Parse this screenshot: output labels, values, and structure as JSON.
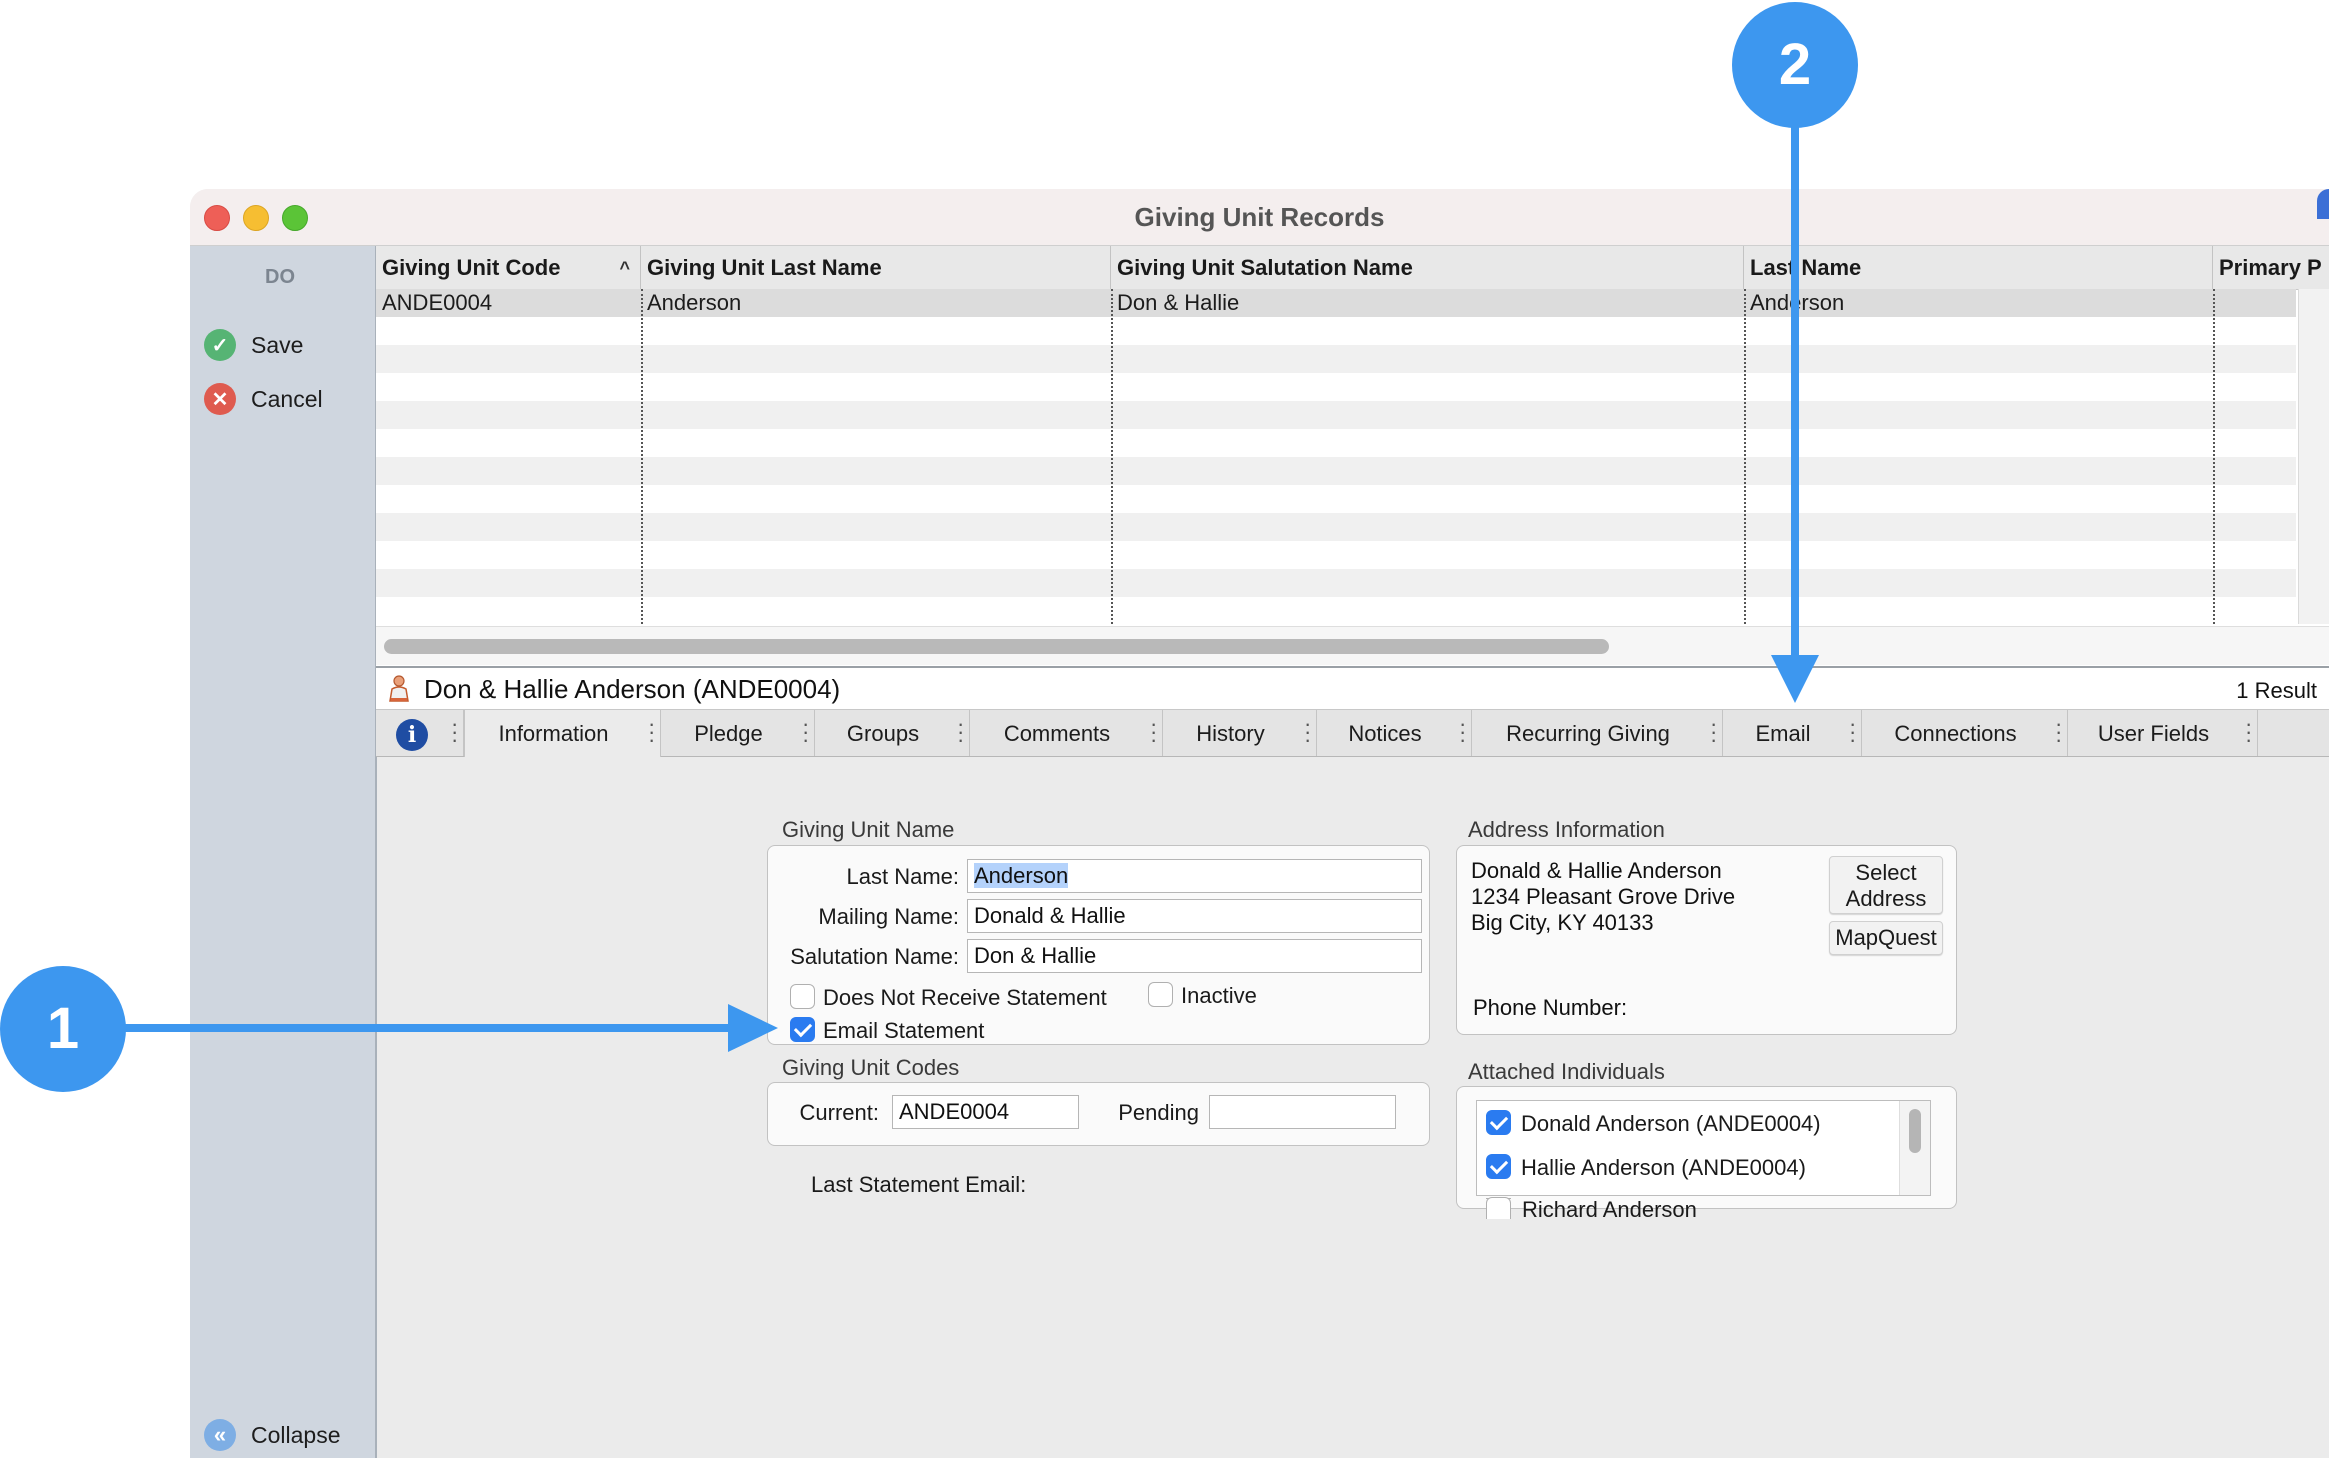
{
  "window": {
    "title": "Giving Unit Records"
  },
  "sidebar": {
    "section_label": "DO",
    "save_label": "Save",
    "cancel_label": "Cancel",
    "collapse_label": "Collapse"
  },
  "grid": {
    "columns": [
      "Giving Unit Code",
      "Giving Unit Last Name",
      "Giving Unit Salutation Name",
      "Last Name",
      "Primary P"
    ],
    "sort_indicator": "^",
    "rows": [
      [
        "ANDE0004",
        "Anderson",
        "Don & Hallie",
        "Anderson",
        ""
      ]
    ]
  },
  "record": {
    "title": "Don & Hallie Anderson (ANDE0004)",
    "result_count": "1 Result"
  },
  "tabs": [
    "Information",
    "Pledge",
    "Groups",
    "Comments",
    "History",
    "Notices",
    "Recurring Giving",
    "Email",
    "Connections",
    "User Fields"
  ],
  "giving_unit_name": {
    "title": "Giving Unit Name",
    "last_name_label": "Last Name:",
    "last_name_value": "Anderson",
    "mailing_name_label": "Mailing Name:",
    "mailing_name_value": "Donald & Hallie",
    "salutation_label": "Salutation Name:",
    "salutation_value": "Don & Hallie",
    "no_statement_label": "Does Not Receive Statement",
    "inactive_label": "Inactive",
    "email_statement_label": "Email Statement"
  },
  "giving_unit_codes": {
    "title": "Giving Unit Codes",
    "current_label": "Current:",
    "current_value": "ANDE0004",
    "pending_label": "Pending",
    "pending_value": ""
  },
  "last_statement_email_label": "Last Statement Email:",
  "address": {
    "title": "Address Information",
    "lines": [
      "Donald & Hallie Anderson",
      "1234 Pleasant Grove Drive",
      "Big City, KY 40133"
    ],
    "select_address_line1": "Select",
    "select_address_line2": "Address",
    "mapquest_label": "MapQuest",
    "phone_label": "Phone Number:"
  },
  "attached": {
    "title": "Attached Individuals",
    "items": [
      {
        "label": "Donald Anderson (ANDE0004)",
        "checked": true
      },
      {
        "label": "Hallie Anderson (ANDE0004)",
        "checked": true
      },
      {
        "label": "Richard Anderson",
        "checked": false
      }
    ]
  },
  "callouts": {
    "one": "1",
    "two": "2"
  },
  "colors": {
    "callout": "#3d97ef",
    "checkbox_on": "#2a7bf0",
    "sidebar": "#cfd6df"
  }
}
